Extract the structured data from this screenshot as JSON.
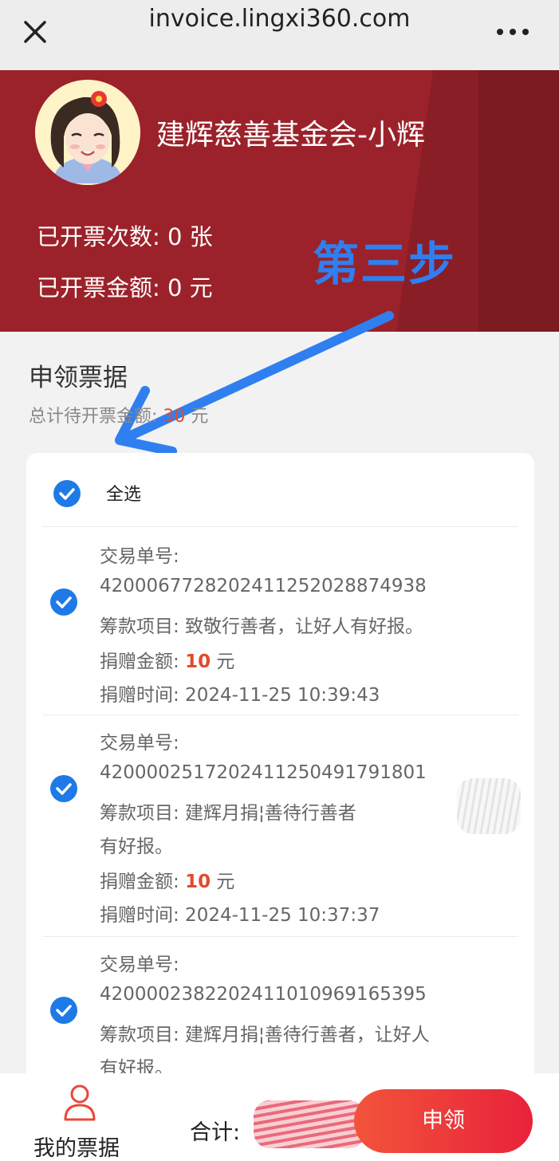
{
  "browser": {
    "title": "invoice.lingxi360.com"
  },
  "header": {
    "org_name": "建辉慈善基金会-小辉",
    "issued_count": "已开票次数: 0 张",
    "issued_amount": "已开票金额: 0 元",
    "bg_color": "#9b222a"
  },
  "annotation": {
    "step_label": "第三步",
    "color": "#2f7ff0"
  },
  "section": {
    "title": "申领票据",
    "total_label": "总计待开票金额:",
    "total_amount": "30",
    "total_unit": "元"
  },
  "list": {
    "select_all_label": "全选",
    "items": [
      {
        "order_label": "交易单号:",
        "order_no": "420006772820241125202887493",
        "order_no_tail": "8",
        "project_line1": "筹款项目: 致敬行善者，让好人有好报。",
        "project_line2": "",
        "amount_label": "捐赠金额: ",
        "amount": "10",
        "amount_unit": " 元",
        "time": "捐赠时间: 2024-11-25 10:39:43"
      },
      {
        "order_label": "交易单号:",
        "order_no": "4200002517202411250491791801",
        "order_no_tail": "",
        "project_line1": "筹款项目: 建辉月捐¦善待行善者",
        "project_line2": "有好报。",
        "amount_label": "捐赠金额: ",
        "amount": "10",
        "amount_unit": " 元",
        "time": "捐赠时间: 2024-11-25 10:37:37"
      },
      {
        "order_label": "交易单号:",
        "order_no": "4200002382202411010969165395",
        "order_no_tail": "",
        "project_line1": "筹款项目: 建辉月捐¦善待行善者，让好人",
        "project_line2": "有好报。",
        "amount_label": "",
        "amount": "",
        "amount_unit": "",
        "time": ""
      }
    ],
    "check_color": "#1e7ae6"
  },
  "bottom": {
    "my_tickets_label": "我的票据",
    "sum_label": "合计:",
    "apply_label": "申领",
    "apply_color": "#ee3a38"
  }
}
